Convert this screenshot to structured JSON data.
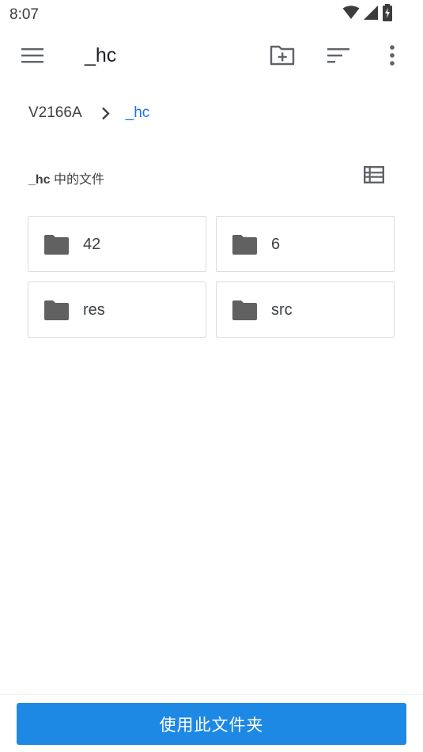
{
  "status_bar": {
    "time": "8:07",
    "icons": [
      "wifi-icon",
      "cell-signal-icon",
      "battery-charging-icon"
    ]
  },
  "toolbar": {
    "title": "_hc",
    "icons": [
      "menu-icon",
      "new-folder-icon",
      "sort-icon",
      "more-vert-icon"
    ]
  },
  "breadcrumb": {
    "root": "V2166A",
    "current": "_hc"
  },
  "section": {
    "folder_name": "_hc",
    "suffix": " 中的文件",
    "view_icon": "list-view-icon"
  },
  "folders": [
    {
      "name": "42"
    },
    {
      "name": "6"
    },
    {
      "name": "res"
    },
    {
      "name": "src"
    }
  ],
  "bottom": {
    "use_folder_label": "使用此文件夹"
  },
  "colors": {
    "accent": "#1e88e5",
    "breadcrumb_active": "#1a73e8",
    "icon_grey": "#616161"
  }
}
